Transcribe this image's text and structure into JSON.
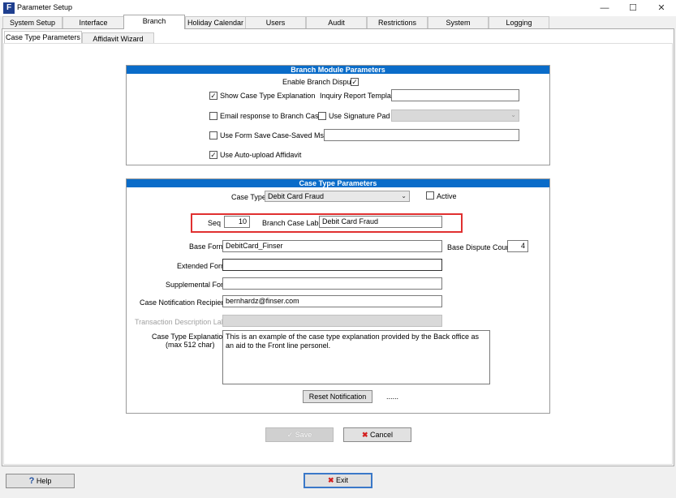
{
  "window": {
    "title": "Parameter Setup",
    "app_icon": "F"
  },
  "tabs": [
    {
      "label": "System Setup"
    },
    {
      "label": "Interface"
    },
    {
      "label": "Branch"
    },
    {
      "label": "Holiday Calendar"
    },
    {
      "label": "Users"
    },
    {
      "label": "Audit"
    },
    {
      "label": "Restrictions"
    },
    {
      "label": "System"
    },
    {
      "label": "Logging"
    }
  ],
  "subtabs": [
    {
      "label": "Case Type Parameters"
    },
    {
      "label": "Affidavit Wizard"
    }
  ],
  "branch_module": {
    "header": "Branch Module Parameters",
    "enable_dispute_label": "Enable Branch Dispute",
    "show_explanation_label": "Show Case Type Explanation",
    "inquiry_template_label": "Inquiry Report Template",
    "inquiry_template_value": "",
    "email_response_label": "Email response to Branch Case",
    "signature_pad_label": "Use Signature Pad",
    "signature_pad_value": "",
    "use_form_save_label": "Use Form Save",
    "case_saved_msg_label": "Case-Saved Msg",
    "case_saved_msg_value": "",
    "auto_upload_label": "Use Auto-upload Affidavit"
  },
  "case_type": {
    "header": "Case Type Parameters",
    "case_type_label": "Case Type",
    "case_type_value": "Debit Card Fraud",
    "active_label": "Active",
    "seq_label": "Seq",
    "seq_value": "10",
    "branch_case_label_label": "Branch Case Label",
    "branch_case_label_value": "Debit Card Fraud",
    "base_form_label": "Base Form",
    "base_form_value": "DebitCard_Finser",
    "base_dispute_count_label": "Base Dispute Count",
    "base_dispute_count_value": "4",
    "extended_form_label": "Extended Form",
    "extended_form_value": "",
    "supplemental_form_label": "Supplemental Form",
    "supplemental_form_value": "",
    "notification_recipients_label": "Case Notification Recipients",
    "notification_recipients_value": "bernhardz@finser.com",
    "transaction_desc_label": "Transaction Description Label",
    "transaction_desc_value": "",
    "explanation_label_1": "Case Type Explanation",
    "explanation_label_2": "(max 512 char)",
    "explanation_value": "This is an example of the case type explanation provided by the Back office as an aid to the Front line personel.",
    "reset_notification_label": "Reset Notification",
    "dots": "......"
  },
  "actions": {
    "save_label": "Save",
    "cancel_label": "Cancel",
    "help_label": "Help",
    "exit_label": "Exit"
  },
  "colors": {
    "header_blue": "#0a6cc9",
    "highlight_red": "#e03030",
    "exit_border": "#3a78c8"
  }
}
